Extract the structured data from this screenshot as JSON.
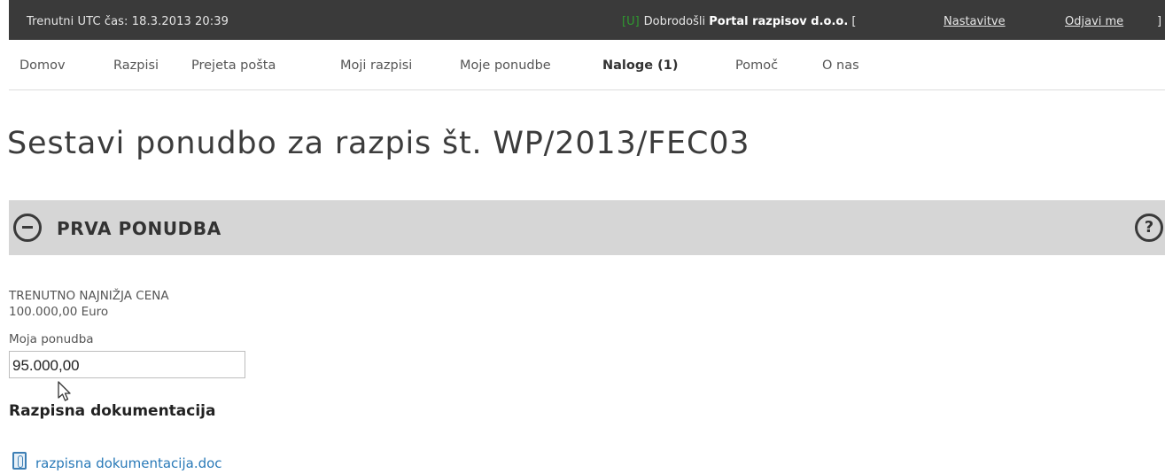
{
  "topbar": {
    "time": "Trenutni UTC čas: 18.3.2013 20:39",
    "status": "[U]",
    "welcome": "Dobrodošli",
    "company": "Portal razpisov d.o.o.",
    "bracket_open": "[",
    "settings": "Nastavitve",
    "logout": "Odjavi me",
    "bracket_close": "]"
  },
  "nav": {
    "items": [
      {
        "label": "Domov"
      },
      {
        "label": "Razpisi"
      },
      {
        "label": "Prejeta pošta"
      },
      {
        "label": "Moji razpisi"
      },
      {
        "label": "Moje ponudbe"
      },
      {
        "label": "Naloge (1)"
      },
      {
        "label": "Pomoč"
      },
      {
        "label": "O nas"
      }
    ],
    "active": "Naloge (1)"
  },
  "page": {
    "title": "Sestavi ponudbo za razpis št. WP/2013/FEC03"
  },
  "section": {
    "title": "PRVA PONUDBA",
    "help_symbol": "?"
  },
  "offer": {
    "lowest_price_label": "TRENUTNO NAJNIŽJA CENA",
    "lowest_price_value": "100.000,00 Euro",
    "my_offer_label": "Moja ponudba",
    "my_offer_value": "95.000,00"
  },
  "documentation": {
    "heading": "Razpisna dokumentacija",
    "file_name": "razpisna dokumentacija.doc"
  },
  "colors": {
    "topbar_bg": "#3a3a3a",
    "section_bg": "#d6d6d6",
    "link": "#2a7ab8",
    "status_green": "#2f9a2f"
  }
}
